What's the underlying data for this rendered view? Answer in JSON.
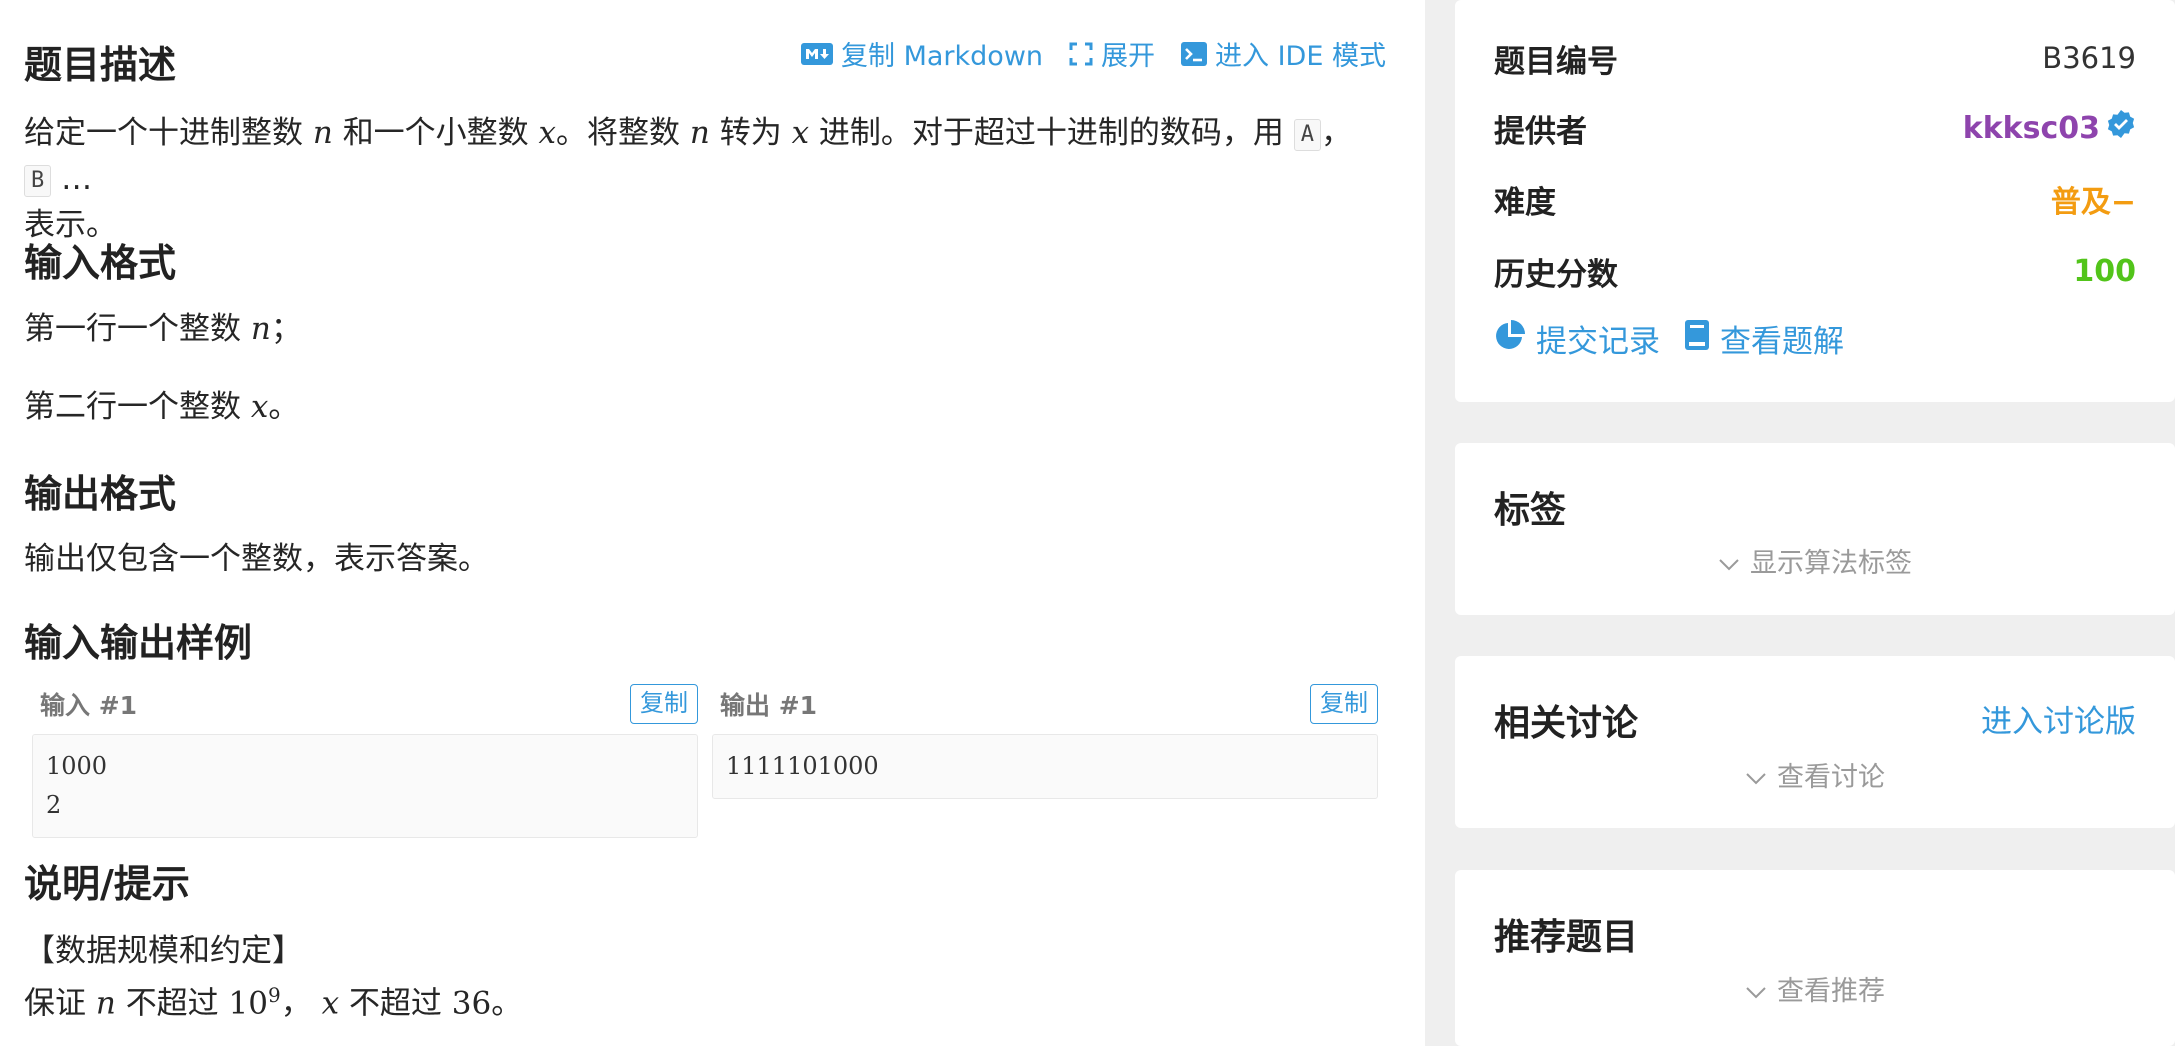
{
  "toolbar": {
    "copy_markdown": "复制 Markdown",
    "expand": "展开",
    "ide_mode": "进入 IDE 模式"
  },
  "sections": {
    "description_title": "题目描述",
    "input_format_title": "输入格式",
    "output_format_title": "输出格式",
    "samples_title": "输入输出样例",
    "hint_title": "说明/提示"
  },
  "description": {
    "p1": "给定一个十进制整数",
    "var_n": "n",
    "p2": "和一个小整数",
    "var_x": "x",
    "p3": "。将整数",
    "p4": "转为",
    "p5": "进制。对于超过十进制的数码，用",
    "code_a": "A",
    "sep": "，",
    "code_b": "B",
    "ellipsis": "…",
    "p6": "表示。"
  },
  "input_format": {
    "line1_text": "第一行一个整数",
    "line1_var": "n",
    "line1_end": "；",
    "line2_text": "第二行一个整数",
    "line2_var": "x",
    "line2_end": "。"
  },
  "output_format": {
    "text": "输出仅包含一个整数，表示答案。"
  },
  "samples": {
    "input_label": "输入 #1",
    "output_label": "输出 #1",
    "copy_label": "复制",
    "input_value": "1000\n2",
    "output_value": "1111101000"
  },
  "hint": {
    "heading": "【数据规模和约定】",
    "t1": "保证",
    "var_n": "n",
    "t2": "不超过",
    "base": "10",
    "exp": "9",
    "t3": "，",
    "var_x": "x",
    "t4": "不超过",
    "num": "36",
    "t5": "。"
  },
  "info_card": {
    "problem_id_label": "题目编号",
    "problem_id": "B3619",
    "provider_label": "提供者",
    "provider": "kkksc03",
    "difficulty_label": "难度",
    "difficulty": "普及−",
    "score_label": "历史分数",
    "score": "100",
    "submissions_link": "提交记录",
    "solutions_link": "查看题解"
  },
  "tags_card": {
    "title": "标签",
    "toggle": "显示算法标签"
  },
  "discuss_card": {
    "title": "相关讨论",
    "enter": "进入讨论版",
    "toggle": "查看讨论"
  },
  "recommend_card": {
    "title": "推荐题目",
    "toggle": "查看推荐"
  },
  "colors": {
    "link": "#3498db",
    "provider": "#8e44ad",
    "difficulty": "#f39c11",
    "score": "#52c41a",
    "verified": "#3498db"
  }
}
